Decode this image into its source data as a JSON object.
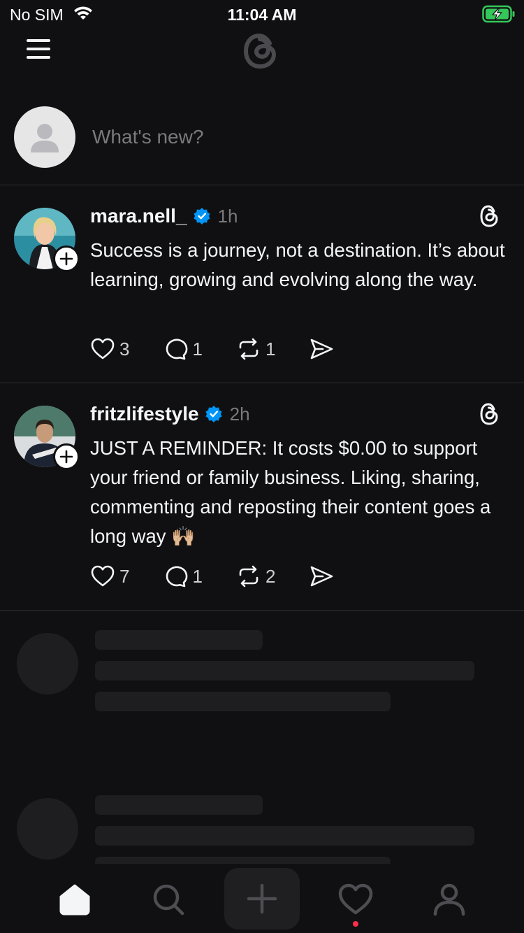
{
  "status_bar": {
    "carrier": "No SIM",
    "time": "11:04 AM",
    "battery_color": "#34c759"
  },
  "top_nav": {
    "menu_icon": "hamburger-menu-icon",
    "logo_icon": "threads-logo-icon"
  },
  "composer": {
    "placeholder": "What's new?"
  },
  "posts": [
    {
      "username": "mara.nell_",
      "verified": true,
      "time": "1h",
      "text": "Success is a journey, not a destination. It’s about learning, growing and evolving along the way.",
      "likes": "3",
      "replies": "1",
      "reposts": "1"
    },
    {
      "username": "fritzlifestyle",
      "verified": true,
      "time": "2h",
      "text": "JUST A REMINDER: It costs $0.00 to support your friend or family business. Liking, sharing, commenting and reposting their content goes a long way 🙌🏼",
      "likes": "7",
      "replies": "1",
      "reposts": "2"
    }
  ],
  "tab_bar": {
    "tabs": [
      "home",
      "search",
      "create",
      "activity",
      "profile"
    ],
    "active": "home",
    "notification_color": "#ff2e4d"
  },
  "colors": {
    "background": "#101012",
    "text": "#f3f5f7",
    "muted": "#7a7a7e",
    "verified": "#0095f6",
    "divider": "#2d2d30"
  }
}
